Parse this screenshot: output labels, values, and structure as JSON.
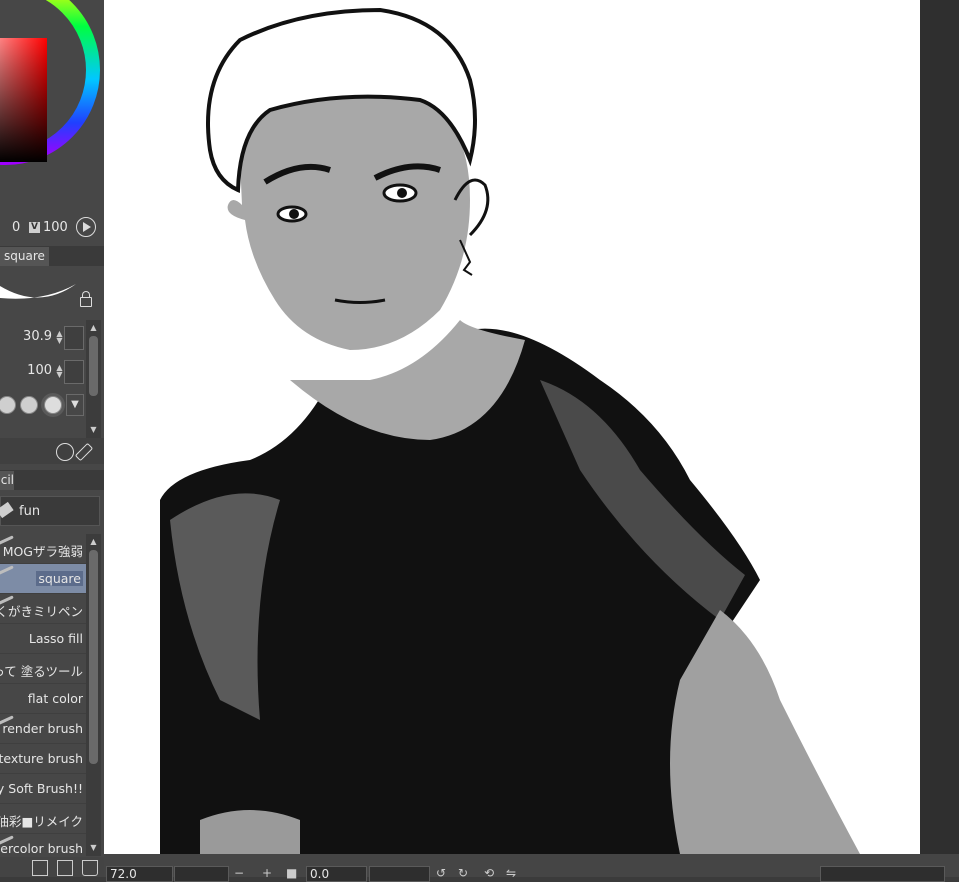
{
  "color_panel": {
    "s_value": "0",
    "v_badge": "V",
    "v_value": "100"
  },
  "tool_property": {
    "tab_label": "square",
    "brush_size": "30.9",
    "opacity": "100"
  },
  "sub_tool": {
    "tab_label": "cil",
    "group_label": "fun",
    "items": [
      {
        "label": "MOGザラ強弱"
      },
      {
        "label": "square"
      },
      {
        "label": "らくがきミリペン"
      },
      {
        "label": "Lasso fill"
      },
      {
        "label": "って 塗るツール"
      },
      {
        "label": "flat color"
      },
      {
        "label": "E render brush"
      },
      {
        "label": "e texture brush"
      },
      {
        "label": "dy Soft Brush!!"
      },
      {
        "label": "ぶ油彩■リメイク"
      },
      {
        "label": "tercolor brush"
      }
    ],
    "selected_index": 1
  },
  "status_bar": {
    "zoom": "72.0",
    "rotation": "0.0"
  },
  "colors": {
    "panel_bg": "#474747",
    "selection": "#5c6c8b",
    "canvas": "#ffffff"
  }
}
